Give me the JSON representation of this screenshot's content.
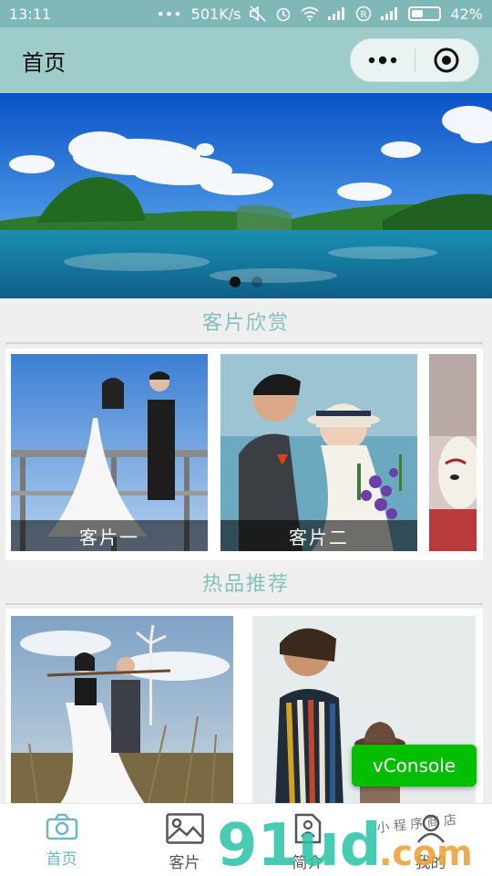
{
  "status_bar": {
    "time": "13:11",
    "dots": "•••",
    "speed": "501K/s",
    "battery": "42%",
    "battery_level": 0.42
  },
  "nav": {
    "title": "首页"
  },
  "banner": {
    "slides": 2,
    "active_index": 0
  },
  "sections": {
    "gallery_title": "客片欣赏",
    "hot_title": "热品推荐"
  },
  "gallery": {
    "items": [
      {
        "caption": "客片一"
      },
      {
        "caption": "客片二"
      }
    ]
  },
  "vconsole": {
    "label": "vConsole"
  },
  "tabbar": {
    "items": [
      {
        "label": "首页",
        "icon": "camera-icon",
        "active": true
      },
      {
        "label": "客片",
        "icon": "image-icon",
        "active": false
      },
      {
        "label": "简介",
        "icon": "document-icon",
        "active": false
      },
      {
        "label": "我的",
        "icon": "user-icon",
        "active": false
      }
    ]
  },
  "watermark": {
    "text": "91ud.com",
    "script": "小程序商店"
  },
  "colors": {
    "accent": "#6bb6c8",
    "nav_bg": "#9dcccb",
    "status_bg": "#7fb8b6",
    "section_title": "#86c0be",
    "vconsole": "#04be02"
  }
}
